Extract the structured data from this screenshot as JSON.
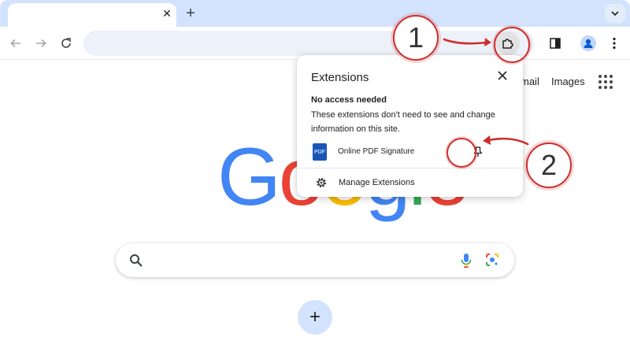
{
  "tab": {
    "title": "",
    "close_glyph": "✕"
  },
  "tabstrip": {
    "new_tab_glyph": "+"
  },
  "toolbar": {
    "address_value": "",
    "address_placeholder": ""
  },
  "ntp": {
    "top_links": [
      {
        "label": "mail"
      },
      {
        "label": "Images"
      }
    ],
    "logo": {
      "letters": [
        "G",
        "o",
        "o",
        "g",
        "l",
        "e"
      ],
      "colors": [
        "#4285F4",
        "#EA4335",
        "#FBBC05",
        "#4285F4",
        "#34A853",
        "#EA4335"
      ]
    },
    "search": {
      "value": "",
      "placeholder": ""
    },
    "add_shortcut_glyph": "+"
  },
  "extensions_popup": {
    "title": "Extensions",
    "section_heading": "No access needed",
    "section_description": "These extensions don't need to see and change information on this site.",
    "extension": {
      "name": "Online PDF Signature",
      "icon_text": "PDF"
    },
    "manage_label": "Manage Extensions"
  },
  "annotations": [
    {
      "label": "1"
    },
    {
      "label": "2"
    }
  ],
  "colors": {
    "tabstrip": "#d3e3fd",
    "omnibox": "#edf2fa",
    "annotation_red": "#cf2d2d",
    "profile_blue": "#0b57d0"
  },
  "icons": [
    "back-icon",
    "forward-icon",
    "reload-icon",
    "puzzle-icon",
    "side-panel-icon",
    "profile-icon",
    "more-icon",
    "apps-grid-icon",
    "search-icon",
    "mic-icon",
    "lens-icon",
    "pin-icon",
    "gear-icon",
    "close-icon",
    "tab-search-icon"
  ]
}
